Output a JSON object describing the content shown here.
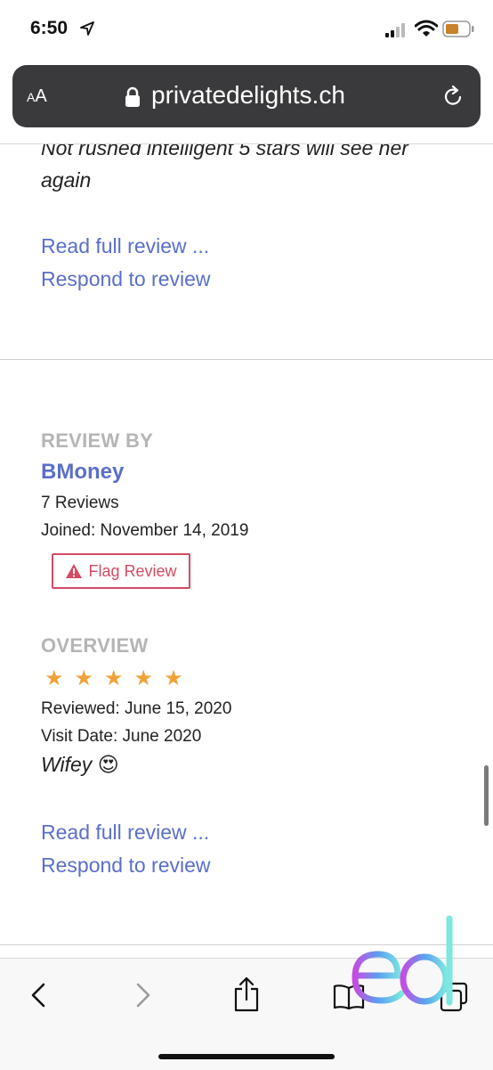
{
  "status_bar": {
    "time": "6:50"
  },
  "browser": {
    "text_size_label": "AA",
    "domain": "privatedelights.ch"
  },
  "review_1": {
    "text_partial": "Not rushed intelligent 5 stars will see her again",
    "read_more": "Read full review ...",
    "respond": "Respond to review"
  },
  "review_2": {
    "review_by_label": "REVIEW BY",
    "reviewer": "BMoney",
    "reviews_count": "7 Reviews",
    "joined": "Joined: November 14, 2019",
    "flag_label": "Flag Review",
    "overview_label": "OVERVIEW",
    "rating": 5,
    "rating_max": 5,
    "reviewed": "Reviewed: June 15, 2020",
    "visit_date": "Visit Date: June 2020",
    "summary": "Wifey",
    "summary_emoji": "😍",
    "read_more": "Read full review ...",
    "respond": "Respond to review"
  },
  "colors": {
    "link": "#5a6fc9",
    "flag": "#d44a63",
    "star": "#f0a33b",
    "label_gray": "#b5b5b5",
    "urlbar": "#3a3a3c"
  },
  "toolbar_icons": [
    "back-icon",
    "forward-icon",
    "share-icon",
    "bookmarks-icon",
    "tabs-icon"
  ]
}
